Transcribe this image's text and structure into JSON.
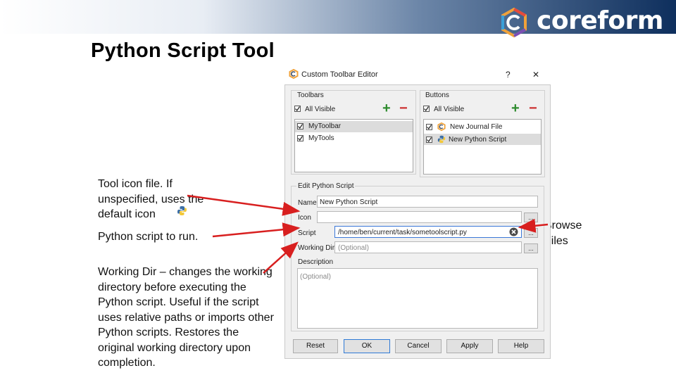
{
  "slide": {
    "title": "Python Script Tool",
    "brand": "coreform"
  },
  "notes": {
    "icon_note": "Tool icon file. If unspecified, uses the default icon",
    "script_note": "Python script to run.",
    "workdir_note": "Working Dir – changes the working directory before executing the Python script. Useful if the script uses relative paths or imports other Python scripts. Restores the original working directory upon completion.",
    "browse_note": "Browse Files"
  },
  "dialog": {
    "title": "Custom Toolbar Editor",
    "help_label": "?",
    "close_label": "✕",
    "toolbars": {
      "label": "Toolbars",
      "all_visible": "All Visible",
      "items": [
        "MyToolbar",
        "MyTools"
      ]
    },
    "buttons": {
      "label": "Buttons",
      "all_visible": "All Visible",
      "items": [
        "New Journal File",
        "New Python Script"
      ]
    },
    "edit": {
      "label": "Edit Python Script",
      "name_label": "Name",
      "name_value": "New Python Script",
      "icon_label": "Icon",
      "icon_value": "",
      "script_label": "Script",
      "script_value": "/home/ben/current/task/sometoolscript.py",
      "workdir_label": "Working Dir",
      "workdir_placeholder": "(Optional)",
      "description_label": "Description",
      "description_placeholder": "(Optional)",
      "browse": "..."
    },
    "footer": {
      "reset": "Reset",
      "ok": "OK",
      "cancel": "Cancel",
      "apply": "Apply",
      "help": "Help"
    }
  },
  "colors": {
    "arrow": "#d81f1f",
    "banner_dark": "#0e2f5d",
    "title": "#000000"
  }
}
